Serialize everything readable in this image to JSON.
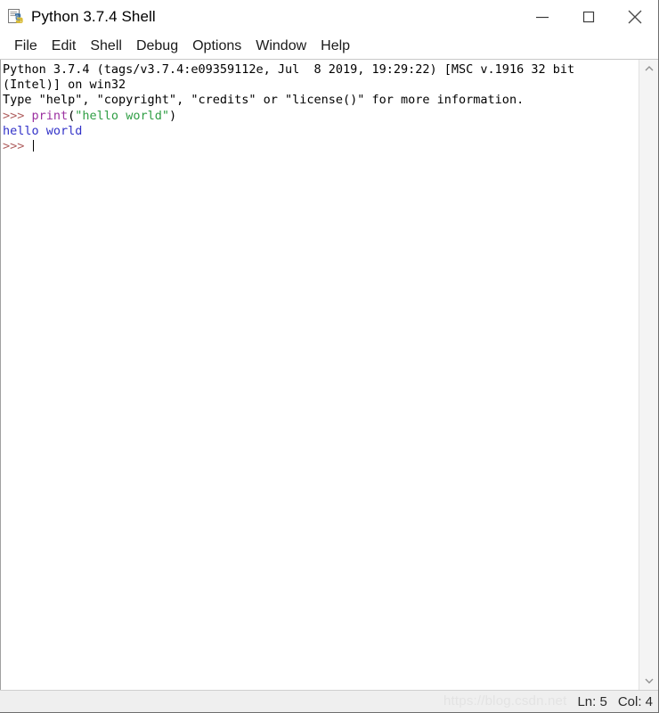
{
  "window": {
    "title": "Python 3.7.4 Shell",
    "icon": "python-file-icon",
    "controls": {
      "minimize": "minimize-icon",
      "maximize": "maximize-icon",
      "close": "close-icon"
    }
  },
  "menubar": {
    "items": [
      {
        "label": "File"
      },
      {
        "label": "Edit"
      },
      {
        "label": "Shell"
      },
      {
        "label": "Debug"
      },
      {
        "label": "Options"
      },
      {
        "label": "Window"
      },
      {
        "label": "Help"
      }
    ]
  },
  "console": {
    "lines": [
      {
        "id": "banner-line-1",
        "segments": [
          {
            "kind": "plain",
            "text": "Python 3.7.4 (tags/v3.7.4:e09359112e, Jul  8 2019, 19:29:22) [MSC v.1916 32 bit"
          }
        ]
      },
      {
        "id": "banner-line-2",
        "segments": [
          {
            "kind": "plain",
            "text": "(Intel)] on win32"
          }
        ]
      },
      {
        "id": "banner-line-3",
        "segments": [
          {
            "kind": "plain",
            "text": "Type \"help\", \"copyright\", \"credits\" or \"license()\" for more information."
          }
        ]
      },
      {
        "id": "input-line-1",
        "segments": [
          {
            "kind": "prompt",
            "text": ">>> "
          },
          {
            "kind": "builtin",
            "text": "print"
          },
          {
            "kind": "punct",
            "text": "("
          },
          {
            "kind": "string",
            "text": "\"hello world\""
          },
          {
            "kind": "punct",
            "text": ")"
          }
        ]
      },
      {
        "id": "output-line-1",
        "segments": [
          {
            "kind": "stdout",
            "text": "hello world"
          }
        ]
      },
      {
        "id": "input-line-2",
        "segments": [
          {
            "kind": "prompt",
            "text": ">>> "
          }
        ]
      }
    ]
  },
  "scrollbar": {
    "up_arrow": "chevron-up-icon",
    "down_arrow": "chevron-down-icon"
  },
  "statusbar": {
    "line_label": "Ln: 5",
    "col_label": "Col: 4",
    "watermark": "https://blog.csdn.net"
  },
  "colors": {
    "prompt": "#b06060",
    "builtin": "#9b30a0",
    "string": "#2f9e44",
    "stdout": "#3232c8",
    "text": "#000000",
    "window_bg": "#ffffff",
    "statusbar_bg": "#efefef",
    "scrollbar_bg": "#f4f4f4"
  }
}
